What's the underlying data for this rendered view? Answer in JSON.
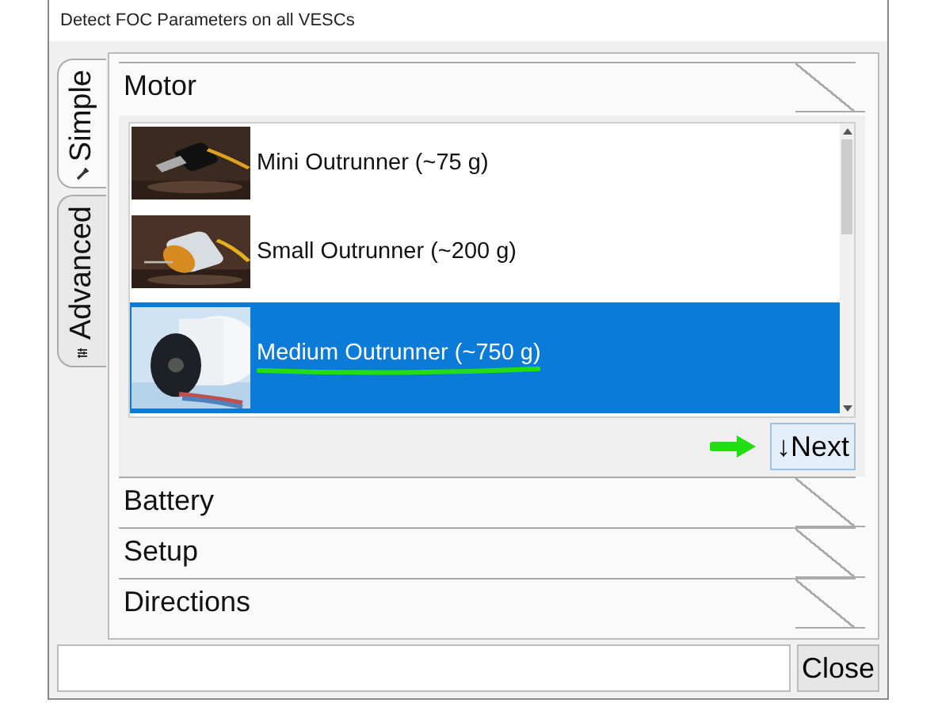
{
  "window": {
    "title": "Detect FOC Parameters on all VESCs"
  },
  "tabs": [
    {
      "label": "Simple",
      "selected": true
    },
    {
      "label": "Advanced",
      "selected": false
    }
  ],
  "sections": [
    {
      "title": "Motor",
      "expanded": true
    },
    {
      "title": "Battery",
      "expanded": false
    },
    {
      "title": "Setup",
      "expanded": false
    },
    {
      "title": "Directions",
      "expanded": false
    }
  ],
  "motor_list": {
    "items": [
      {
        "label": "Mini Outrunner (~75 g)",
        "selected": false
      },
      {
        "label": "Small Outrunner (~200 g)",
        "selected": false
      },
      {
        "label": "Medium Outrunner (~750 g)",
        "selected": true,
        "underlined": true
      }
    ]
  },
  "next_button": {
    "label": "↓Next",
    "pointer_arrow": true
  },
  "close_button": {
    "label": "Close"
  }
}
